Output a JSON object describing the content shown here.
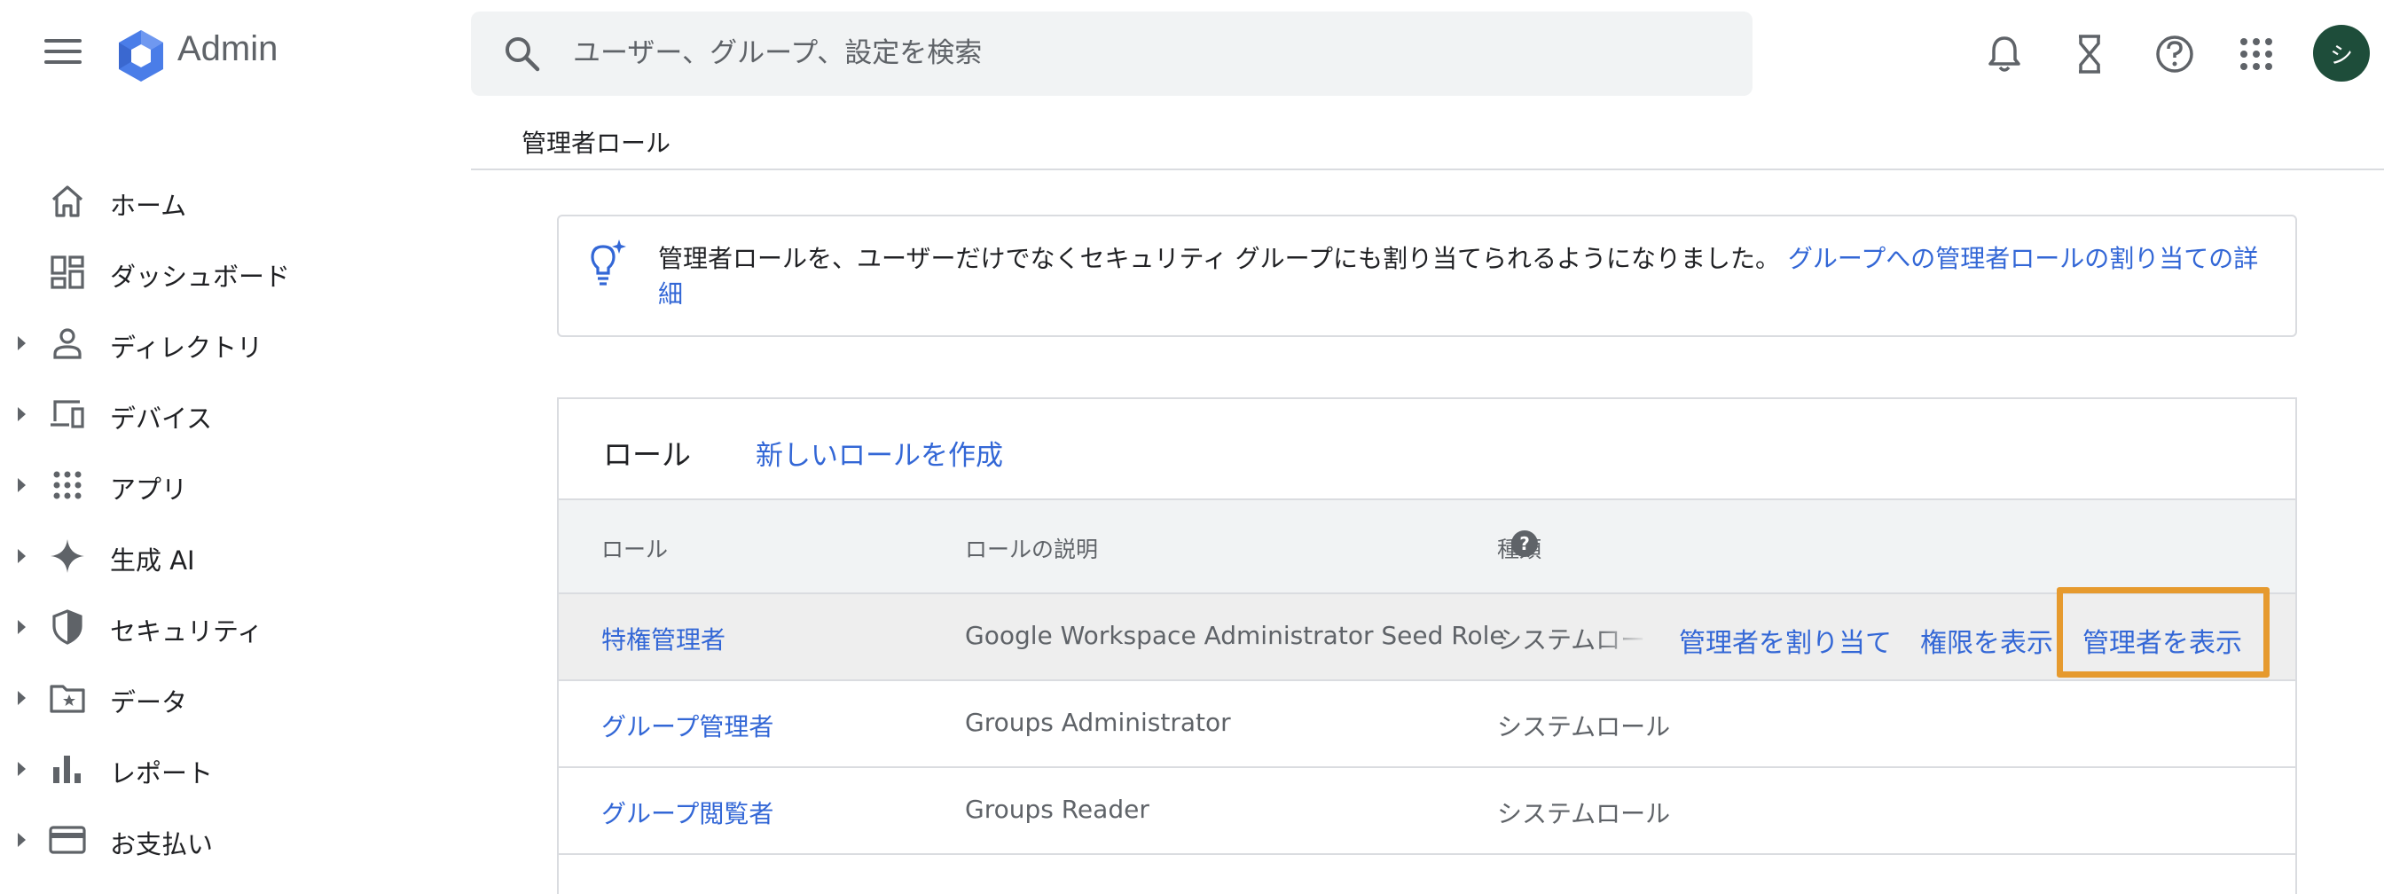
{
  "app": {
    "name": "Admin"
  },
  "search": {
    "placeholder": "ユーザー、グループ、設定を検索"
  },
  "header_icons": [
    "bell-icon",
    "hourglass-icon",
    "help-circle-icon",
    "apps-grid-icon"
  ],
  "user": {
    "avatar_initial": "シ",
    "avatar_color": "#1e4d3a"
  },
  "breadcrumb": "管理者ロール",
  "sidebar": {
    "items": [
      {
        "label": "ホーム",
        "icon": "home-icon",
        "expandable": false
      },
      {
        "label": "ダッシュボード",
        "icon": "dashboard-icon",
        "expandable": false
      },
      {
        "label": "ディレクトリ",
        "icon": "person-icon",
        "expandable": true
      },
      {
        "label": "デバイス",
        "icon": "devices-icon",
        "expandable": true
      },
      {
        "label": "アプリ",
        "icon": "apps-icon",
        "expandable": true
      },
      {
        "label": "生成 AI",
        "icon": "sparkle-icon",
        "expandable": true
      },
      {
        "label": "セキュリティ",
        "icon": "shield-icon",
        "expandable": true
      },
      {
        "label": "データ",
        "icon": "folder-star-icon",
        "expandable": true
      },
      {
        "label": "レポート",
        "icon": "bar-chart-icon",
        "expandable": true
      },
      {
        "label": "お支払い",
        "icon": "credit-card-icon",
        "expandable": true
      }
    ]
  },
  "banner": {
    "text": "管理者ロールを、ユーザーだけでなくセキュリティ グループにも割り当てられるようになりました。",
    "link": "グループへの管理者ロールの割り当ての詳細"
  },
  "roles": {
    "title": "ロール",
    "create_link": "新しいロールを作成",
    "columns": [
      "ロール",
      "ロールの説明",
      "種類"
    ],
    "rows": [
      {
        "role": "特権管理者",
        "description": "Google Workspace Administrator Seed Role",
        "type": "システムロール"
      },
      {
        "role": "グループ管理者",
        "description": "Groups Administrator",
        "type": "システムロール"
      },
      {
        "role": "グループ閲覧者",
        "description": "Groups Reader",
        "type": "システムロール"
      }
    ],
    "row_actions": {
      "assign": "管理者を割り当て",
      "view_permissions": "権限を表示",
      "view_admins": "管理者を表示"
    }
  },
  "colors": {
    "link": "#3367d6",
    "highlight": "#e69a2e",
    "header_bg": "#f1f3f4"
  }
}
